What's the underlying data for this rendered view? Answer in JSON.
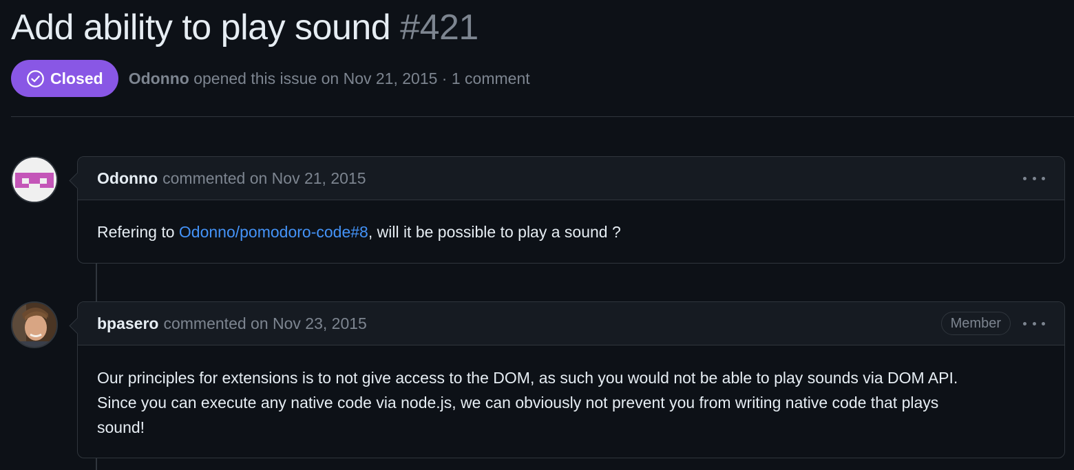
{
  "issue": {
    "title": "Add ability to play sound",
    "number": "#421",
    "state": "Closed",
    "state_color": "#8957e5",
    "author": "Odonno",
    "opened_text": "opened this issue on Nov 21, 2015 · 1 comment"
  },
  "comments": [
    {
      "author": "Odonno",
      "meta": "commented on Nov 21, 2015",
      "avatar_icon": "identicon-avatar",
      "body_prefix": "Refering to ",
      "body_link": "Odonno/pomodoro-code#8",
      "body_suffix": ", will it be possible to play a sound ?"
    },
    {
      "author": "bpasero",
      "meta": "commented on Nov 23, 2015",
      "role": "Member",
      "avatar_icon": "photo-avatar",
      "body_lines": [
        "Our principles for extensions is to not give access to the DOM, as such you would not be able to play sounds via DOM API.",
        "Since you can execute any native code via node.js, we can obviously not prevent you from writing native code that plays",
        "sound!"
      ]
    }
  ],
  "colors": {
    "background": "#0d1117",
    "link": "#4493f8",
    "border": "#30363d",
    "muted": "#7d8590"
  }
}
